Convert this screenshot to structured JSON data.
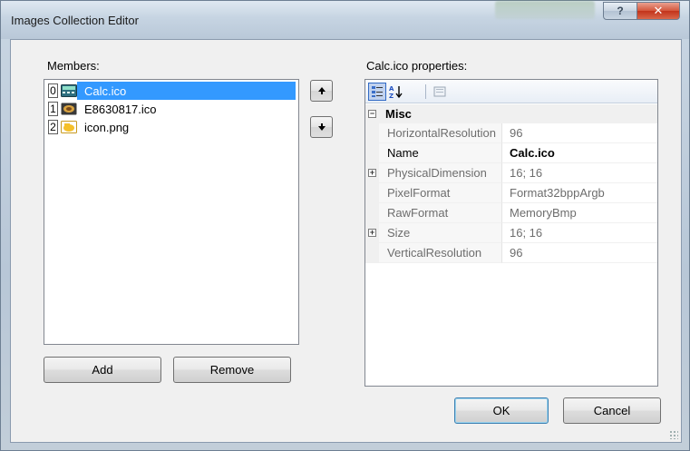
{
  "window": {
    "title": "Images Collection Editor",
    "help_glyph": "?",
    "close_glyph": "✕"
  },
  "members": {
    "label": "Members:",
    "items": [
      {
        "index": "0",
        "name": "Calc.ico",
        "icon": "calculator-icon",
        "selected": true
      },
      {
        "index": "1",
        "name": "E8630817.ico",
        "icon": "image-icon",
        "selected": false
      },
      {
        "index": "2",
        "name": "icon.png",
        "icon": "folder-icon",
        "selected": false
      }
    ],
    "move_up_glyph": "🠕",
    "move_down_glyph": "🠗"
  },
  "buttons": {
    "add": "Add",
    "remove": "Remove",
    "ok": "OK",
    "cancel": "Cancel"
  },
  "properties": {
    "label": "Calc.ico properties:",
    "category": "Misc",
    "category_toggle": "−",
    "rows": [
      {
        "name": "HorizontalResolution",
        "value": "96",
        "expandable": false,
        "bold": false
      },
      {
        "name": "Name",
        "value": "Calc.ico",
        "expandable": false,
        "bold": true
      },
      {
        "name": "PhysicalDimension",
        "value": "16; 16",
        "expandable": true,
        "bold": false
      },
      {
        "name": "PixelFormat",
        "value": "Format32bppArgb",
        "expandable": false,
        "bold": false
      },
      {
        "name": "RawFormat",
        "value": "MemoryBmp",
        "expandable": false,
        "bold": false
      },
      {
        "name": "Size",
        "value": "16; 16",
        "expandable": true,
        "bold": false
      },
      {
        "name": "VerticalResolution",
        "value": "96",
        "expandable": false,
        "bold": false
      }
    ],
    "expand_glyph": "+"
  },
  "colors": {
    "selection": "#3399ff",
    "window_bg": "#f0f0f0",
    "close_button": "#c2331a"
  }
}
